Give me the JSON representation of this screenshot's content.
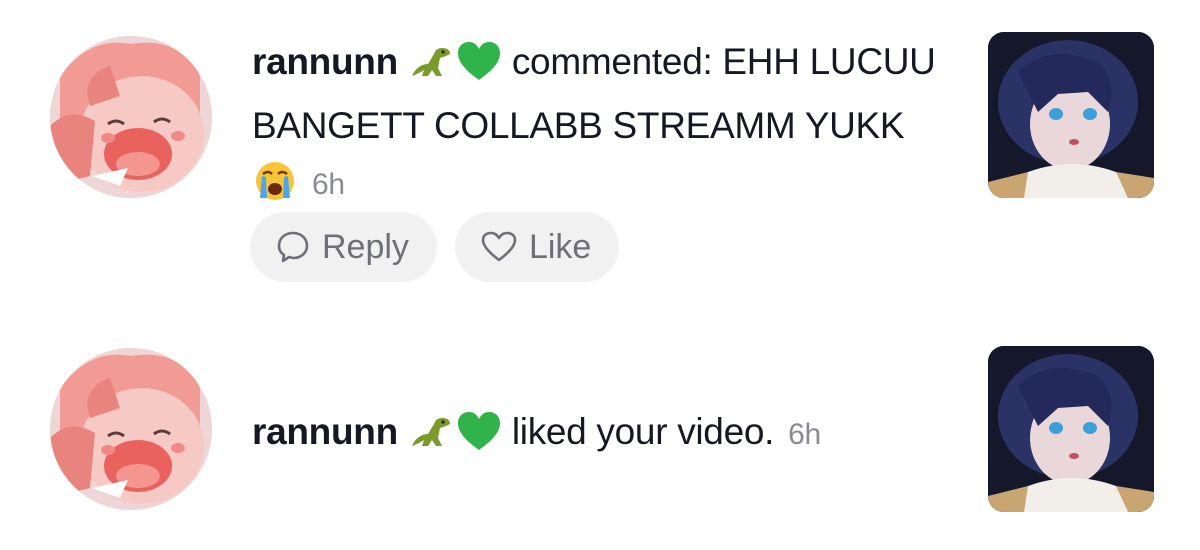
{
  "notifications": [
    {
      "username": "rannunn",
      "badges": [
        "t-rex-emoji",
        "green-heart-emoji"
      ],
      "action": "commented: EHH LUCUU BANGETT COLLABB STREAMM YUKK",
      "trailing_emoji": "loudly-crying-face-emoji",
      "time": "6h",
      "buttons": {
        "reply": "Reply",
        "like": "Like"
      }
    },
    {
      "username": "rannunn",
      "badges": [
        "t-rex-emoji",
        "green-heart-emoji"
      ],
      "action": "liked your video.",
      "time": "6h"
    }
  ],
  "colors": {
    "text": "#161823",
    "muted": "#8a8b91",
    "pill_bg": "#f1f1f2",
    "green_heart": "#2fb34a"
  }
}
